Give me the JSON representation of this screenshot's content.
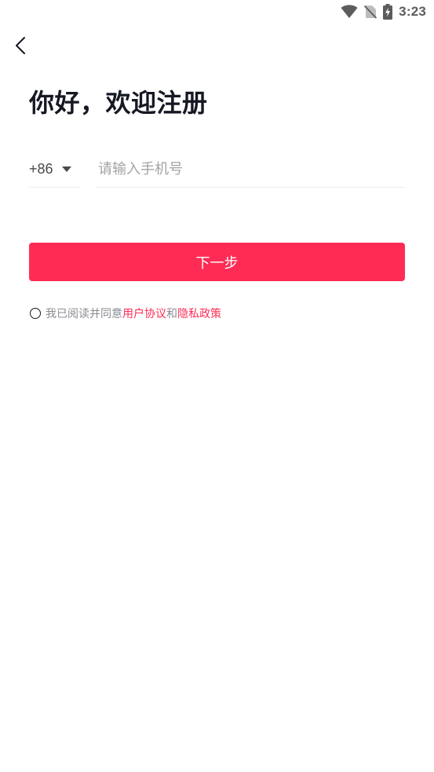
{
  "status_bar": {
    "time": "3:23",
    "icons": [
      "wifi-icon",
      "no-sim-icon",
      "battery-charging-icon"
    ]
  },
  "header": {
    "back_icon": "chevron-left-icon"
  },
  "title": "你好，欢迎注册",
  "phone": {
    "country_code": "+86",
    "caret_icon": "caret-down-icon",
    "placeholder": "请输入手机号",
    "value": ""
  },
  "next_button": {
    "label": "下一步"
  },
  "agreement": {
    "checked": false,
    "prefix": "我已阅读并同意",
    "user_agreement_link": "用户协议",
    "conjunction": "和",
    "privacy_policy_link": "隐私政策"
  },
  "colors": {
    "accent": "#fe2c55",
    "title_text": "#161823",
    "secondary_text": "#8a8b91",
    "placeholder_text": "#a3a3a3",
    "divider": "#ececec"
  }
}
